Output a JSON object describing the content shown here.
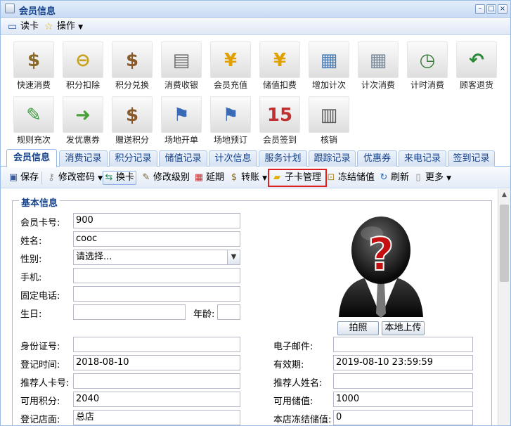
{
  "window": {
    "title": "会员信息",
    "controls": [
      "–",
      "□",
      "×"
    ]
  },
  "menubar": {
    "read_card": "读卡",
    "operations": "操作"
  },
  "icon_buttons": [
    {
      "label": "快速消费",
      "icon": "money-bag-dollar-icon",
      "glyph": "$",
      "color": "#8a6a2a"
    },
    {
      "label": "积分扣除",
      "icon": "coins-minus-icon",
      "glyph": "⊖",
      "color": "#c7a21b"
    },
    {
      "label": "积分兑换",
      "icon": "money-bag-exchange-icon",
      "glyph": "$",
      "color": "#8a5a2a"
    },
    {
      "label": "消费收银",
      "icon": "cash-register-icon",
      "glyph": "▤",
      "color": "#6b6b6b"
    },
    {
      "label": "会员充值",
      "icon": "yen-plus-icon",
      "glyph": "¥",
      "color": "#e0a000"
    },
    {
      "label": "储值扣费",
      "icon": "yen-minus-icon",
      "glyph": "¥",
      "color": "#e0a000"
    },
    {
      "label": "增加计次",
      "icon": "calculator-add-icon",
      "glyph": "▦",
      "color": "#4a7bb5"
    },
    {
      "label": "计次消费",
      "icon": "calculator-icon",
      "glyph": "▦",
      "color": "#7a8a9a"
    },
    {
      "label": "计时消费",
      "icon": "clock-coins-icon",
      "glyph": "◷",
      "color": "#3a7a3a"
    },
    {
      "label": "顾客退货",
      "icon": "customer-return-icon",
      "glyph": "↶",
      "color": "#2a8a3a"
    },
    {
      "label": "规则充次",
      "icon": "rule-recharge-icon",
      "glyph": "✎",
      "color": "#3a9a3a"
    },
    {
      "label": "发优惠券",
      "icon": "coupon-send-icon",
      "glyph": "➜",
      "color": "#4aa03a"
    },
    {
      "label": "赠送积分",
      "icon": "gift-points-icon",
      "glyph": "$",
      "color": "#8a5a2a"
    },
    {
      "label": "场地开单",
      "icon": "venue-open-icon",
      "glyph": "⚑",
      "color": "#3a6ab5"
    },
    {
      "label": "场地预订",
      "icon": "venue-booking-icon",
      "glyph": "⚑",
      "color": "#3a6ab5"
    },
    {
      "label": "会员签到",
      "icon": "calendar-checkin-icon",
      "glyph": "15",
      "color": "#c03030"
    },
    {
      "label": "核销",
      "icon": "barcode-scan-icon",
      "glyph": "▥",
      "color": "#555555"
    }
  ],
  "tabs": [
    "会员信息",
    "消费记录",
    "积分记录",
    "储值记录",
    "计次信息",
    "服务计划",
    "跟踪记录",
    "优惠券",
    "来电记录",
    "签到记录"
  ],
  "toolbar": {
    "save": "保存",
    "change_password": "修改密码",
    "change_card": "换卡",
    "change_level": "修改级别",
    "extend": "延期",
    "transfer": "转账",
    "sub_card": "子卡管理",
    "freeze": "冻结储值",
    "refresh": "刷新",
    "more": "更多"
  },
  "form": {
    "section_title": "基本信息",
    "card_no": {
      "label": "会员卡号:",
      "value": "900"
    },
    "name": {
      "label": "姓名:",
      "value": "cooc"
    },
    "gender": {
      "label": "性别:",
      "value": "请选择..."
    },
    "mobile": {
      "label": "手机:",
      "value": ""
    },
    "phone": {
      "label": "固定电话:",
      "value": ""
    },
    "birthday": {
      "label": "生日:",
      "value": ""
    },
    "age": {
      "label": "年龄:",
      "value": ""
    },
    "id_no": {
      "label": "身份证号:",
      "value": ""
    },
    "email": {
      "label": "电子邮件:",
      "value": ""
    },
    "reg_time": {
      "label": "登记时间:",
      "value": "2018-08-10"
    },
    "valid_until": {
      "label": "有效期:",
      "value": "2019-08-10 23:59:59"
    },
    "referrer_card": {
      "label": "推荐人卡号:",
      "value": ""
    },
    "referrer_name": {
      "label": "推荐人姓名:",
      "value": ""
    },
    "points": {
      "label": "可用积分:",
      "value": "2040"
    },
    "balance": {
      "label": "可用储值:",
      "value": "1000"
    },
    "store": {
      "label": "登记店面:",
      "value": "总店"
    },
    "frozen": {
      "label": "本店冻结储值:",
      "value": "0"
    },
    "photo_btn": "拍照",
    "upload_btn": "本地上传"
  }
}
